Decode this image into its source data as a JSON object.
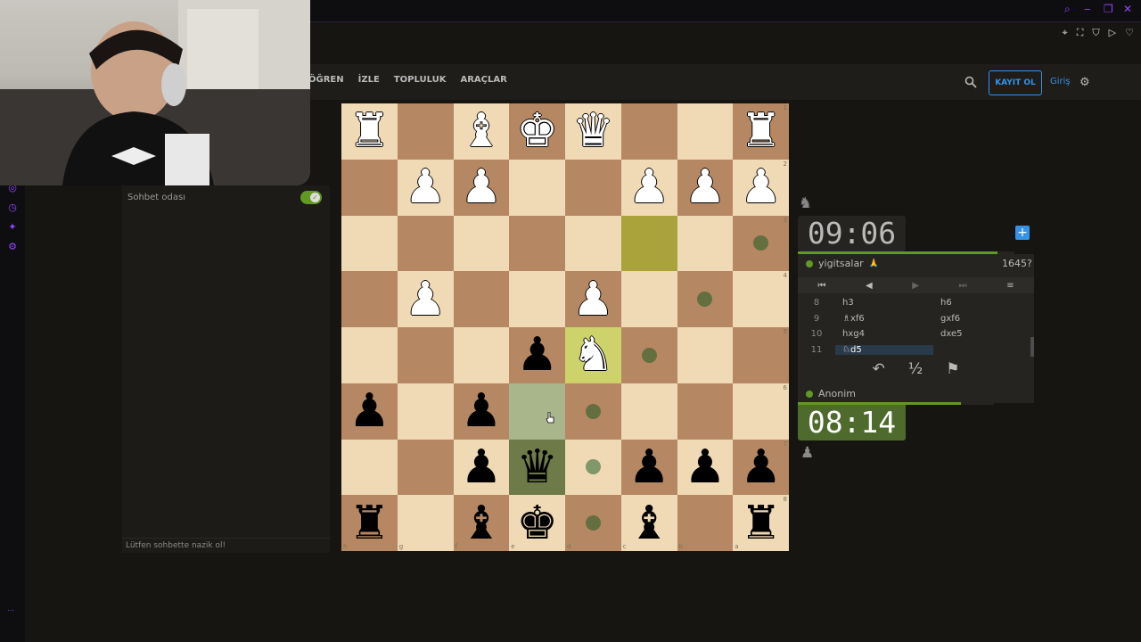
{
  "nav": {
    "items": [
      "ÖĞREN",
      "İZLE",
      "TOPLULUK",
      "ARAÇLAR"
    ],
    "signup_label": "KAYIT OL",
    "login_label": "Giriş"
  },
  "chat": {
    "title": "Sohbet odası",
    "placeholder": "Lütfen sohbette nazik ol!"
  },
  "board": {
    "files": [
      "h",
      "g",
      "f",
      "e",
      "d",
      "c",
      "b",
      "a"
    ],
    "ranks": [
      "1",
      "2",
      "3",
      "4",
      "5",
      "6",
      "7",
      "8"
    ],
    "rows": [
      [
        "♜",
        "",
        "♝",
        "♚",
        "♛",
        "",
        "",
        "♜"
      ],
      [
        "",
        "♟",
        "♟",
        "",
        "",
        "♟",
        "♟",
        "♟"
      ],
      [
        "",
        "",
        "",
        "",
        "",
        "",
        "",
        ""
      ],
      [
        "",
        "♟",
        "",
        "",
        "♟",
        "",
        "",
        ""
      ],
      [
        "",
        "",
        "",
        "♟",
        "♞",
        "",
        "",
        ""
      ],
      [
        "♟",
        "",
        "♟",
        "",
        "",
        "",
        "",
        ""
      ],
      [
        "",
        "",
        "♟",
        "♛",
        "",
        "♟",
        "♟",
        "♟"
      ],
      [
        "♜",
        "",
        "♝",
        "♚",
        "",
        "♝",
        "",
        "♜"
      ]
    ],
    "colors": [
      [
        "w",
        "",
        "w",
        "w",
        "w",
        "",
        "",
        "w"
      ],
      [
        "",
        "w",
        "w",
        "",
        "",
        "w",
        "w",
        "w"
      ],
      [
        "",
        "",
        "",
        "",
        "",
        "",
        "",
        ""
      ],
      [
        "",
        "w",
        "",
        "",
        "w",
        "",
        "",
        ""
      ],
      [
        "",
        "",
        "",
        "b",
        "w",
        "",
        "",
        ""
      ],
      [
        "b",
        "",
        "b",
        "",
        "",
        "",
        "",
        ""
      ],
      [
        "",
        "",
        "b",
        "b",
        "",
        "b",
        "b",
        "b"
      ],
      [
        "b",
        "",
        "b",
        "b",
        "",
        "b",
        "",
        "b"
      ]
    ],
    "highlights": {
      "last_move": [
        [
          2,
          5
        ],
        [
          4,
          4
        ]
      ],
      "selected": [
        [
          5,
          3
        ],
        [
          6,
          3
        ]
      ],
      "move_dots": [
        [
          2,
          7
        ],
        [
          3,
          6
        ],
        [
          4,
          5
        ],
        [
          5,
          4
        ],
        [
          6,
          4
        ],
        [
          7,
          4
        ]
      ]
    },
    "colors_theme": {
      "light": "#f0d9b5",
      "dark": "#b58863"
    }
  },
  "clock_top": "09:06",
  "clock_bottom": "08:14",
  "player_top": {
    "name": "yigitsalar",
    "badge": "🙏",
    "rating": "1645?"
  },
  "player_bottom": {
    "name": "Anonim"
  },
  "moves": [
    {
      "num": "8",
      "white": "h3",
      "black": "h6"
    },
    {
      "num": "9",
      "white": "♗xf6",
      "black": "gxf6"
    },
    {
      "num": "10",
      "white": "hxg4",
      "black": "dxe5"
    },
    {
      "num": "11",
      "white": "♘d5",
      "black": ""
    }
  ],
  "actions": {
    "takeback": "↶",
    "draw": "½",
    "resign": "⚑"
  },
  "nav_buttons": {
    "first": "⏮",
    "prev": "◀",
    "next": "▶",
    "last": "⏭",
    "menu": "≡"
  },
  "icons": {
    "knight_top": "♞",
    "pawn_bottom": "♟",
    "plus": "+",
    "gear": "⚙",
    "check": "✓"
  },
  "clock_top_progress": 0.92,
  "clock_bottom_progress": 0.83
}
